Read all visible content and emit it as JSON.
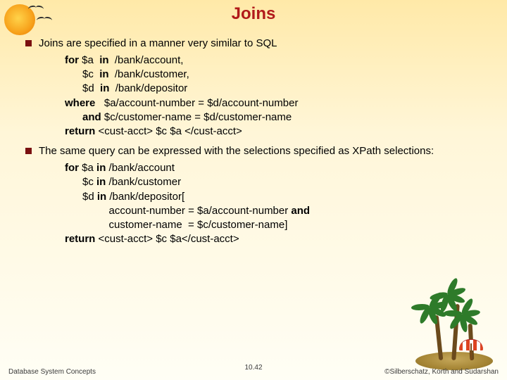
{
  "title": "Joins",
  "bullets": {
    "b1": "Joins are specified in a manner very similar to SQL",
    "b2": "The same query can be expressed with the selections specified as XPath selections:"
  },
  "code1": {
    "l1a": "for",
    "l1b": " $a  ",
    "l1c": "in",
    "l1d": "  /bank/account,",
    "l2a": "      $c  ",
    "l2b": "in",
    "l2c": "  /bank/customer,",
    "l3a": "      $d  ",
    "l3b": "in",
    "l3c": "  /bank/depositor",
    "l4a": "where",
    "l4b": "   $a/account-number = $d/account-number",
    "l5a": "      ",
    "l5b": "and",
    "l5c": " $c/customer-name = $d/customer-name",
    "l6a": "return",
    "l6b": " <cust-acct> $c $a </cust-acct>"
  },
  "code2": {
    "l1a": "for",
    "l1b": " $a ",
    "l1c": "in",
    "l1d": " /bank/account",
    "l2a": "      $c ",
    "l2b": "in",
    "l2c": " /bank/customer",
    "l3a": "      $d ",
    "l3b": "in",
    "l3c": " /bank/depositor[",
    "l4": "               account-number = $a/account-number ",
    "l4b": "and",
    "l5": "               customer-name  = $c/customer-name]",
    "l6a": "return",
    "l6b": " <cust-acct> $c $a</cust-acct>"
  },
  "footer": {
    "left": "Database System Concepts",
    "center": "10.42",
    "right": "©Silberschatz, Korth and Sudarshan"
  }
}
